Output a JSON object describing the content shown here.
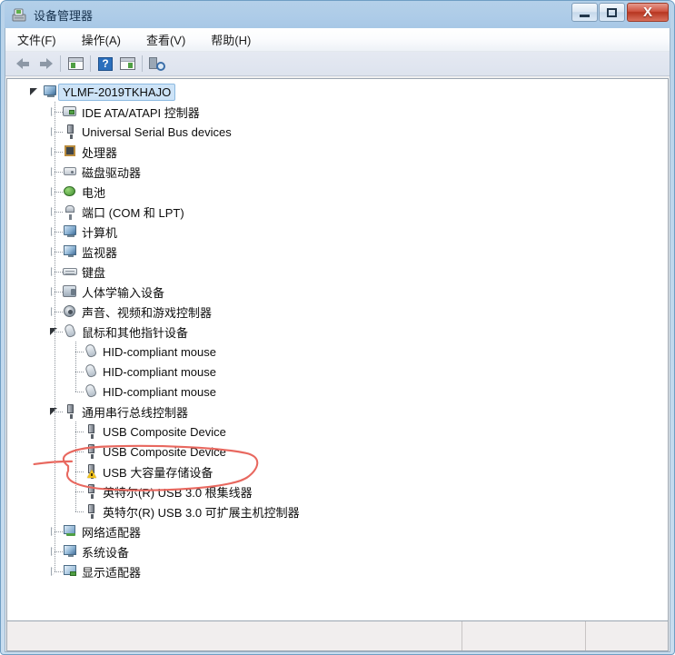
{
  "window": {
    "title": "设备管理器",
    "icon": "device-manager-icon",
    "buttons": {
      "minimize": "最小化",
      "maximize": "最大化",
      "close": "X"
    }
  },
  "menubar": {
    "items": [
      {
        "label": "文件(F)",
        "name": "menu-file"
      },
      {
        "label": "操作(A)",
        "name": "menu-action"
      },
      {
        "label": "查看(V)",
        "name": "menu-view"
      },
      {
        "label": "帮助(H)",
        "name": "menu-help"
      }
    ]
  },
  "toolbar": {
    "items": [
      {
        "name": "back-button",
        "icon": "arrow-left-icon"
      },
      {
        "name": "forward-button",
        "icon": "arrow-right-icon"
      },
      {
        "name": "properties-button",
        "icon": "properties-icon"
      },
      {
        "name": "help-button",
        "icon": "question-mark-icon"
      },
      {
        "name": "update-driver-button",
        "icon": "update-driver-icon"
      },
      {
        "name": "scan-hardware-button",
        "icon": "scan-hardware-icon"
      }
    ]
  },
  "tree": {
    "root": {
      "label": "YLMF-2019TKHAJO",
      "icon": "computer-icon",
      "expanded": true,
      "selected": true
    },
    "nodes": [
      {
        "label": "IDE ATA/ATAPI 控制器",
        "icon": "ide-controller-icon",
        "level": 1,
        "state": "collapsed"
      },
      {
        "label": "Universal Serial Bus devices",
        "icon": "usb-icon",
        "level": 1,
        "state": "collapsed"
      },
      {
        "label": "处理器",
        "icon": "processor-icon",
        "level": 1,
        "state": "collapsed"
      },
      {
        "label": "磁盘驱动器",
        "icon": "disk-drive-icon",
        "level": 1,
        "state": "collapsed"
      },
      {
        "label": "电池",
        "icon": "battery-icon",
        "level": 1,
        "state": "collapsed"
      },
      {
        "label": "端口 (COM 和 LPT)",
        "icon": "port-icon",
        "level": 1,
        "state": "collapsed"
      },
      {
        "label": "计算机",
        "icon": "computer-icon",
        "level": 1,
        "state": "collapsed"
      },
      {
        "label": "监视器",
        "icon": "monitor-icon",
        "level": 1,
        "state": "collapsed"
      },
      {
        "label": "键盘",
        "icon": "keyboard-icon",
        "level": 1,
        "state": "collapsed"
      },
      {
        "label": "人体学输入设备",
        "icon": "hid-icon",
        "level": 1,
        "state": "collapsed"
      },
      {
        "label": "声音、视频和游戏控制器",
        "icon": "sound-icon",
        "level": 1,
        "state": "collapsed"
      },
      {
        "label": "鼠标和其他指针设备",
        "icon": "mouse-icon",
        "level": 1,
        "state": "expanded"
      },
      {
        "label": "HID-compliant mouse",
        "icon": "mouse-icon",
        "level": 2,
        "state": "leaf"
      },
      {
        "label": "HID-compliant mouse",
        "icon": "mouse-icon",
        "level": 2,
        "state": "leaf"
      },
      {
        "label": "HID-compliant mouse",
        "icon": "mouse-icon",
        "level": 2,
        "state": "leaf"
      },
      {
        "label": "通用串行总线控制器",
        "icon": "usb-icon",
        "level": 1,
        "state": "expanded"
      },
      {
        "label": "USB Composite Device",
        "icon": "usb-icon",
        "level": 2,
        "state": "leaf"
      },
      {
        "label": "USB Composite Device",
        "icon": "usb-icon",
        "level": 2,
        "state": "leaf"
      },
      {
        "label": "USB 大容量存储设备",
        "icon": "usb-warning-icon",
        "level": 2,
        "state": "leaf",
        "warning": true
      },
      {
        "label": "英特尔(R) USB 3.0 根集线器",
        "icon": "usb-icon",
        "level": 2,
        "state": "leaf"
      },
      {
        "label": "英特尔(R) USB 3.0 可扩展主机控制器",
        "icon": "usb-icon",
        "level": 2,
        "state": "leaf"
      },
      {
        "label": "网络适配器",
        "icon": "network-adapter-icon",
        "level": 1,
        "state": "collapsed"
      },
      {
        "label": "系统设备",
        "icon": "system-device-icon",
        "level": 1,
        "state": "collapsed"
      },
      {
        "label": "显示适配器",
        "icon": "display-adapter-icon",
        "level": 1,
        "state": "collapsed"
      }
    ]
  },
  "annotation": {
    "color": "#e8685f",
    "shape": "ellipse-with-leader-line",
    "target": "USB 大容量存储设备"
  },
  "statusbar": {
    "left": "",
    "middle": "",
    "right": ""
  },
  "colors": {
    "titlebar": "#aecce8",
    "selection": "#cde3f7",
    "annotation": "#e8685f",
    "warning": "#f2c21b"
  }
}
